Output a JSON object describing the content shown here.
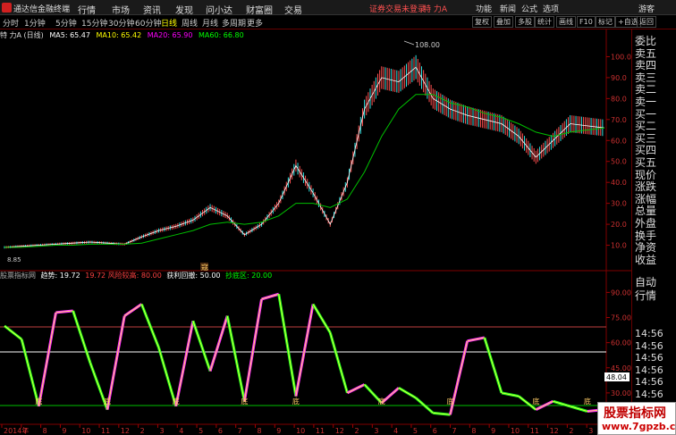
{
  "app": {
    "name": "通达信金融终端"
  },
  "menu": [
    "行情",
    "市场",
    "资讯",
    "发现",
    "问小达",
    "财富圈",
    "交易"
  ],
  "header_right": {
    "warning": "证券交易未登录",
    "stock_title": "特 力A",
    "links": [
      "功能",
      "新闻",
      "公式",
      "选项"
    ],
    "guest": "游客"
  },
  "toolbar": {
    "periods": [
      "分时",
      "1分钟",
      "5分钟",
      "15分钟",
      "30分钟",
      "60分钟",
      "日线",
      "周线",
      "月线",
      "多周期",
      "更多"
    ],
    "active_period": "日线",
    "buttons": [
      "复权",
      "叠加",
      "多股",
      "统计",
      "画线",
      "F10",
      "标记",
      "+自选",
      "返回"
    ]
  },
  "main_chart": {
    "stock": "特 力A (日线)",
    "ma": [
      {
        "label": "MA5: 65.47",
        "color": "#ffffff"
      },
      {
        "label": "MA10: 65.42",
        "color": "#ffff00"
      },
      {
        "label": "MA20: 65.90",
        "color": "#ff00ff"
      },
      {
        "label": "MA60: 66.80",
        "color": "#00ff00"
      }
    ],
    "high_label": "108.00",
    "low_label": "8.85",
    "marker": "寇"
  },
  "sub_chart": {
    "title": "股票指标网",
    "trend_label": "趋势: 19.72",
    "items": [
      {
        "label": "19.72 风险较高: 80.00",
        "color": "#ff4040"
      },
      {
        "label": "获利回撤: 50.00",
        "color": "#ffffff"
      },
      {
        "label": "抄底区: 20.00",
        "color": "#00ff00"
      }
    ],
    "current_value": "48.04",
    "bottom_label": "底"
  },
  "right_panel": {
    "items": [
      "委比",
      "卖五",
      "卖四",
      "卖三",
      "卖二",
      "卖一",
      "买一",
      "买二",
      "买三",
      "买四",
      "买五",
      "现价",
      "涨跌",
      "涨幅",
      "总量",
      "外盘",
      "换手",
      "净资",
      "收益"
    ],
    "lower_tabs": [
      "自动",
      "行情"
    ],
    "times": [
      "14:56",
      "14:56",
      "14:56",
      "14:56",
      "14:56",
      "14:56",
      "14:56",
      "14:56",
      "14:56"
    ]
  },
  "x_axis_labels": [
    "2014年",
    "7",
    "8",
    "9",
    "10",
    "11",
    "12",
    "2",
    "3",
    "4",
    "5",
    "6",
    "7",
    "8",
    "9",
    "10",
    "11",
    "12",
    "2",
    "3",
    "4",
    "5",
    "6",
    "7",
    "8",
    "9",
    "10",
    "11",
    "12",
    "2",
    "3"
  ],
  "watermark": {
    "line1": "股票指标网",
    "line2": "www.7gpzb.com"
  },
  "chart_data": [
    {
      "type": "line",
      "title": "",
      "ylim": [
        0,
        110
      ],
      "y_ticks": [
        10.0,
        20.0,
        30.0,
        40.0,
        50.0,
        60.0,
        70.0,
        80.0,
        90.0,
        100.0
      ],
      "x": [
        0,
        4,
        8,
        12,
        16,
        20,
        24,
        28,
        32,
        36,
        40,
        44,
        48,
        52,
        56,
        60,
        64,
        68,
        72,
        76,
        80,
        84,
        88,
        92,
        96,
        100,
        104,
        108,
        112,
        116,
        120,
        124,
        128,
        132,
        136,
        140
      ],
      "series": [
        {
          "name": "MA5",
          "values": [
            9,
            9.5,
            10,
            10.5,
            11,
            11.5,
            11,
            10.5,
            14,
            17,
            19,
            22,
            28,
            24,
            15,
            20,
            30,
            48,
            35,
            20,
            40,
            75,
            90,
            88,
            95,
            80,
            75,
            72,
            70,
            68,
            62,
            52,
            60,
            68,
            67,
            66
          ]
        },
        {
          "name": "MA60",
          "values": [
            9,
            9,
            9.5,
            10,
            10,
            10.5,
            10.5,
            10.5,
            11,
            13,
            15,
            17,
            20,
            21,
            20,
            21,
            24,
            30,
            30,
            28,
            32,
            45,
            62,
            75,
            82,
            82,
            78,
            76,
            73,
            71,
            68,
            64,
            62,
            64,
            65,
            66
          ]
        }
      ]
    },
    {
      "type": "line",
      "title": "",
      "ylim": [
        15,
        95
      ],
      "y_ticks": [
        15.0,
        30.0,
        45.0,
        60.0,
        75.0,
        90.0
      ],
      "reference_lines": [
        80,
        50,
        20
      ],
      "x": [
        0,
        4,
        8,
        12,
        16,
        20,
        24,
        28,
        32,
        36,
        40,
        44,
        48,
        52,
        56,
        60,
        64,
        68,
        72,
        76,
        80,
        84,
        88,
        92,
        96,
        100,
        104,
        108,
        112,
        116,
        120,
        124,
        128,
        132,
        136,
        140
      ],
      "series": [
        {
          "name": "趋势",
          "values": [
            70,
            62,
            22,
            78,
            79,
            48,
            20,
            76,
            83,
            57,
            22,
            73,
            43,
            76,
            25,
            86,
            89,
            28,
            83,
            66,
            30,
            35,
            24,
            33,
            27,
            18,
            17,
            61,
            63,
            30,
            28,
            20,
            25,
            22,
            19,
            20
          ]
        }
      ]
    }
  ]
}
